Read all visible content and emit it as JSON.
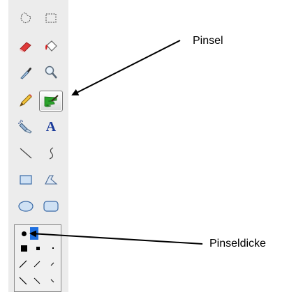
{
  "toolbar": {
    "tools": [
      {
        "id": "free-select",
        "icon": "lasso-select-icon"
      },
      {
        "id": "rect-select",
        "icon": "rect-select-icon"
      },
      {
        "id": "eraser",
        "icon": "eraser-icon"
      },
      {
        "id": "fill",
        "icon": "paint-bucket-icon"
      },
      {
        "id": "color-picker",
        "icon": "eyedropper-icon"
      },
      {
        "id": "magnifier",
        "icon": "magnifier-icon"
      },
      {
        "id": "pencil",
        "icon": "pencil-icon"
      },
      {
        "id": "brush",
        "icon": "brush-icon",
        "selected": true
      },
      {
        "id": "airbrush",
        "icon": "airbrush-icon"
      },
      {
        "id": "text",
        "icon": "text-icon",
        "glyph": "A"
      },
      {
        "id": "line",
        "icon": "line-icon"
      },
      {
        "id": "curve",
        "icon": "curve-icon"
      },
      {
        "id": "rectangle",
        "icon": "rectangle-icon"
      },
      {
        "id": "polygon",
        "icon": "polygon-icon"
      },
      {
        "id": "ellipse",
        "icon": "ellipse-icon"
      },
      {
        "id": "rounded-rectangle",
        "icon": "rounded-rectangle-icon"
      }
    ],
    "brush_sizes_selected": "round-medium"
  },
  "annotations": {
    "brush_label": "Pinsel",
    "brush_size_label": "Pinseldicke"
  },
  "colors": {
    "toolbar_bg": "#ececec",
    "accent_green": "#2aa32a",
    "selection_blue": "#1e6fe0"
  }
}
